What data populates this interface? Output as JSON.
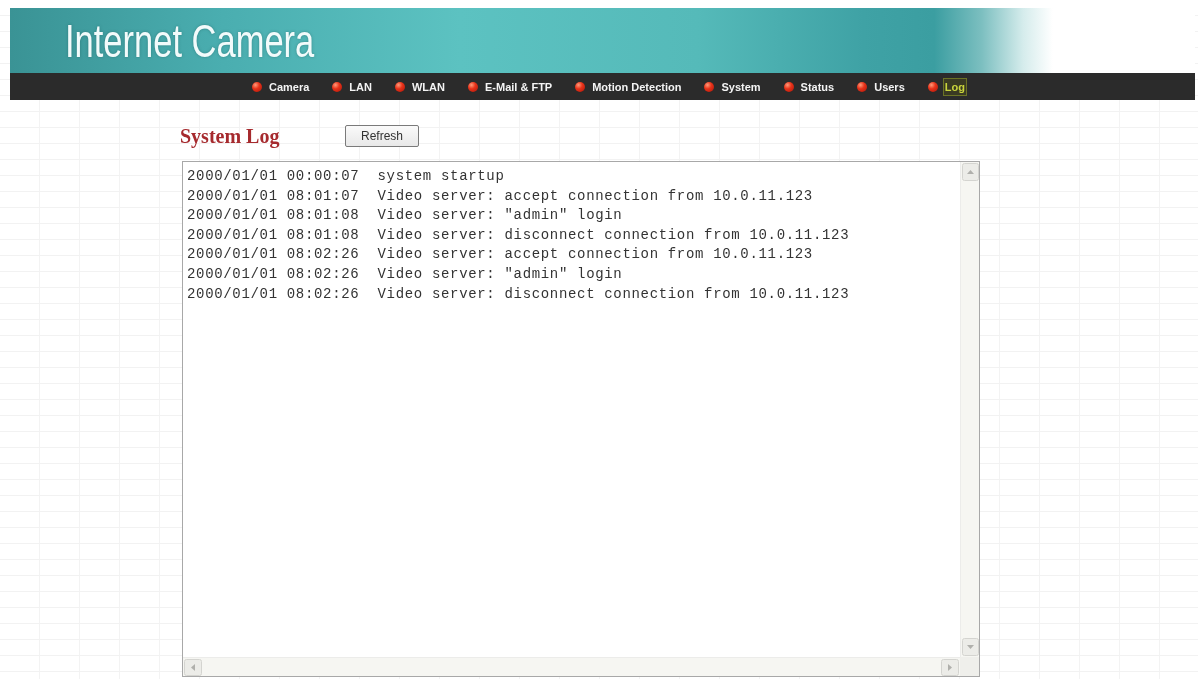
{
  "header": {
    "title": "Internet Camera"
  },
  "nav": [
    {
      "label": "Camera",
      "selected": false
    },
    {
      "label": "LAN",
      "selected": false
    },
    {
      "label": "WLAN",
      "selected": false
    },
    {
      "label": "E-Mail & FTP",
      "selected": false
    },
    {
      "label": "Motion Detection",
      "selected": false
    },
    {
      "label": "System",
      "selected": false
    },
    {
      "label": "Status",
      "selected": false
    },
    {
      "label": "Users",
      "selected": false
    },
    {
      "label": "Log",
      "selected": true
    }
  ],
  "section": {
    "title": "System Log",
    "refresh_button": "Refresh"
  },
  "log": {
    "lines": [
      "2000/01/01 00:00:07  system startup",
      "2000/01/01 08:01:07  Video server: accept connection from 10.0.11.123",
      "2000/01/01 08:01:08  Video server: \"admin\" login",
      "2000/01/01 08:01:08  Video server: disconnect connection from 10.0.11.123",
      "2000/01/01 08:02:26  Video server: accept connection from 10.0.11.123",
      "2000/01/01 08:02:26  Video server: \"admin\" login",
      "2000/01/01 08:02:26  Video server: disconnect connection from 10.0.11.123"
    ]
  }
}
